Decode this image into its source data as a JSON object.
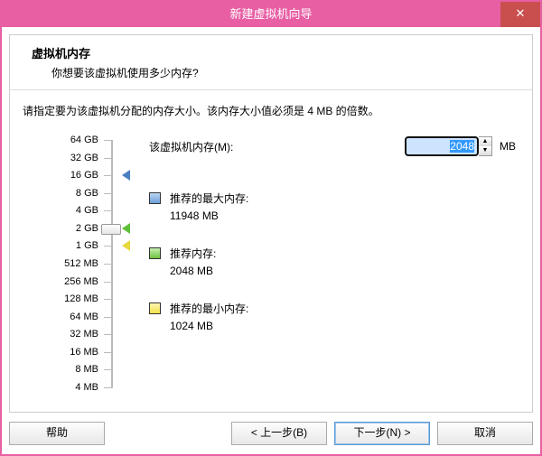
{
  "title": "新建虚拟机向导",
  "header": {
    "title": "虚拟机内存",
    "sub": "你想要该虚拟机使用多少内存?"
  },
  "instruction": "请指定要为该虚拟机分配的内存大小。该内存大小值必须是 4 MB 的倍数。",
  "memory": {
    "label": "该虚拟机内存(M):",
    "value": "2048",
    "unit": "MB"
  },
  "slider": {
    "ticks": [
      "64 GB",
      "32 GB",
      "16 GB",
      "8 GB",
      "4 GB",
      "2 GB",
      "1 GB",
      "512 MB",
      "256 MB",
      "128 MB",
      "64 MB",
      "32 MB",
      "16 MB",
      "8 MB",
      "4 MB"
    ],
    "current_index": 5,
    "max_marker_index": 2,
    "rec_marker_index": 5,
    "min_marker_index": 6
  },
  "recommend": {
    "max": {
      "label": "推荐的最大内存:",
      "value": "11948 MB"
    },
    "rec": {
      "label": "推荐内存:",
      "value": "2048 MB"
    },
    "min": {
      "label": "推荐的最小内存:",
      "value": "1024 MB"
    }
  },
  "buttons": {
    "help": "帮助",
    "back": "< 上一步(B)",
    "next": "下一步(N) >",
    "cancel": "取消"
  },
  "icons": {
    "close": "✕",
    "up": "▲",
    "down": "▼"
  }
}
